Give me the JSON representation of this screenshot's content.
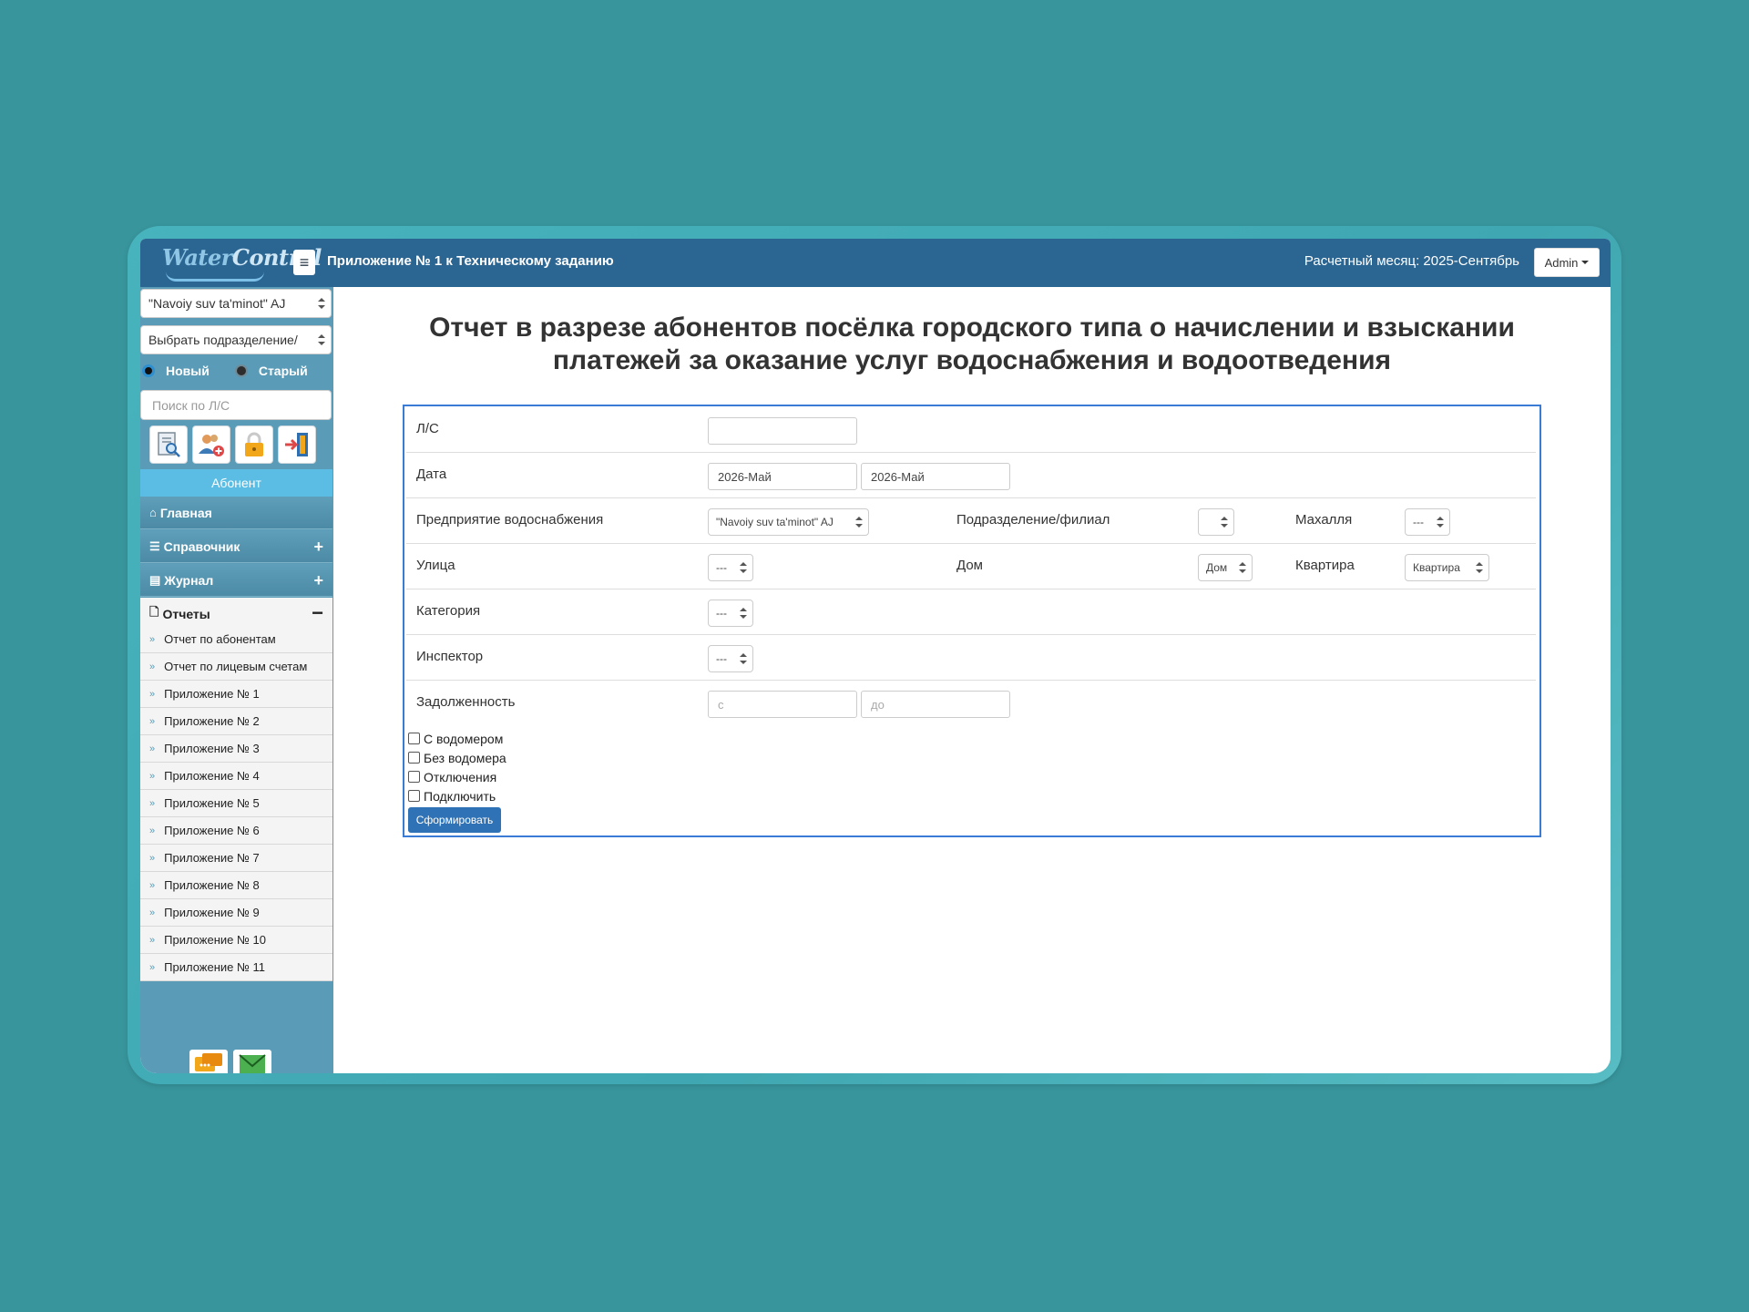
{
  "header": {
    "logo_text": "WaterControl",
    "logo_part1": "Water",
    "logo_part2": "Control",
    "app_title": "Приложение № 1 к Техническому заданию",
    "period": "Расчетный месяц: 2025-Сентябрь",
    "user_menu": "Admin"
  },
  "sidebar": {
    "enterprise_select": "\"Navoiy suv ta'minot\" AJ",
    "division_select": "Выбрать подразделение/",
    "radio_new": "Новый",
    "radio_old": "Старый",
    "radio_selected": "Новый",
    "search_placeholder": "Поиск по Л/С",
    "abonent_label": "Абонент",
    "nav": [
      {
        "label": "Главная",
        "icon": "home-icon"
      },
      {
        "label": "Справочник",
        "icon": "list-icon",
        "toggle": "+"
      },
      {
        "label": "Журнал",
        "icon": "journal-icon",
        "toggle": "+"
      },
      {
        "label": "Отчеты",
        "icon": "file-icon",
        "toggle": "−"
      }
    ],
    "reports": [
      "Отчет по абонентам",
      "Отчет по лицевым счетам",
      "Приложение № 1",
      "Приложение № 2",
      "Приложение № 3",
      "Приложение № 4",
      "Приложение № 5",
      "Приложение № 6",
      "Приложение № 7",
      "Приложение № 8",
      "Приложение № 9",
      "Приложение № 10",
      "Приложение № 11"
    ]
  },
  "main": {
    "title_line1": "Отчет в разрезе абонентов посёлка городского типа о начислении и взыскании",
    "title_line2": "платежей за оказание услуг водоснабжения и водоотведения",
    "form": {
      "ls_label": "Л/С",
      "ls_value": "",
      "date_label": "Дата",
      "date_from": "2026-Май",
      "date_to": "2026-Май",
      "enterprise_label": "Предприятие водоснабжения",
      "enterprise_value": "\"Navoiy suv ta'minot\" AJ",
      "division_label": "Подразделение/филиал",
      "division_value": "",
      "mahalla_label": "Махалля",
      "mahalla_value": "---",
      "street_label": "Улица",
      "street_value": "---",
      "house_label": "Дом",
      "house_value": "Дом",
      "apartment_label": "Квартира",
      "apartment_value": "Квартира",
      "category_label": "Категория",
      "category_value": "---",
      "inspector_label": "Инспектор",
      "inspector_value": "---",
      "debt_label": "Задолженность",
      "debt_from_placeholder": "с",
      "debt_to_placeholder": "до",
      "checkboxes": [
        "С водомером",
        "Без водомера",
        "Отключения",
        "Подключить"
      ],
      "submit_label": "Сформировать"
    }
  }
}
